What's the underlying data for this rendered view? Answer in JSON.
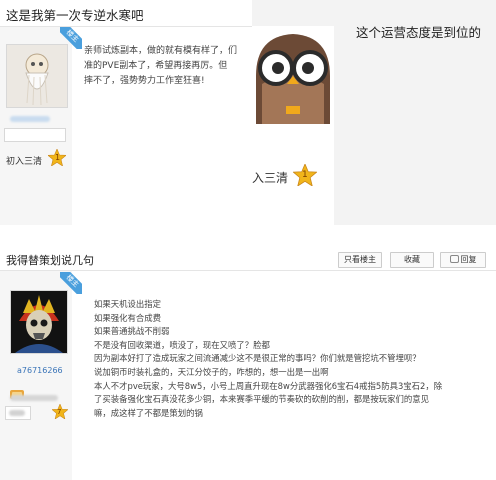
{
  "post1": {
    "title": "这是我第一次专逆水寒吧",
    "ribbon": "楼主",
    "rank": "初入三清",
    "rank_level": "1",
    "content": [
      "亲师试炼副本，做的就有模有样了，们",
      "准的PVE副本了，希望再接再厉。但",
      "摔不了，强势势力工作室狂喜!"
    ]
  },
  "right_image": {
    "caption": "这个运营态度是到位的",
    "rank": "入三清",
    "rank_level": "1"
  },
  "post2": {
    "title": "我得替策划说几句",
    "buttons": {
      "only_op": "只看楼主",
      "favorite": "收藏",
      "reply": "回复"
    },
    "ribbon": "楼主",
    "username": "a76716266",
    "rank_level": "7",
    "lines": [
      "如果天机设出指定",
      "如果强化有合成费",
      "如果普通挑战不削弱",
      "不是没有回收渠道，喷没了，现在又喷了？脸都",
      "因为副本好打了造成玩家之间流通减少这不是很正常的事吗？你们就是管挖坑不管埋呗？",
      "说加铜币时装礼盒的，天江分饺子的，咋想的，想一出是一出啊",
      "本人不才pve玩家，大号8w5，小号上周直升现在8w分武器强化6宝石4戒指5防具3宝石2，除",
      "了买装备强化宝石真没花多少铜，本来赛季平缓的节奏砍的砍削的削，都是按玩家们的意见",
      "嘛，成这样了不都是策划的锅"
    ]
  },
  "colors": {
    "ribbon": "#4a9fdd",
    "username": "#3a74b8",
    "star": "#f1b51a"
  }
}
